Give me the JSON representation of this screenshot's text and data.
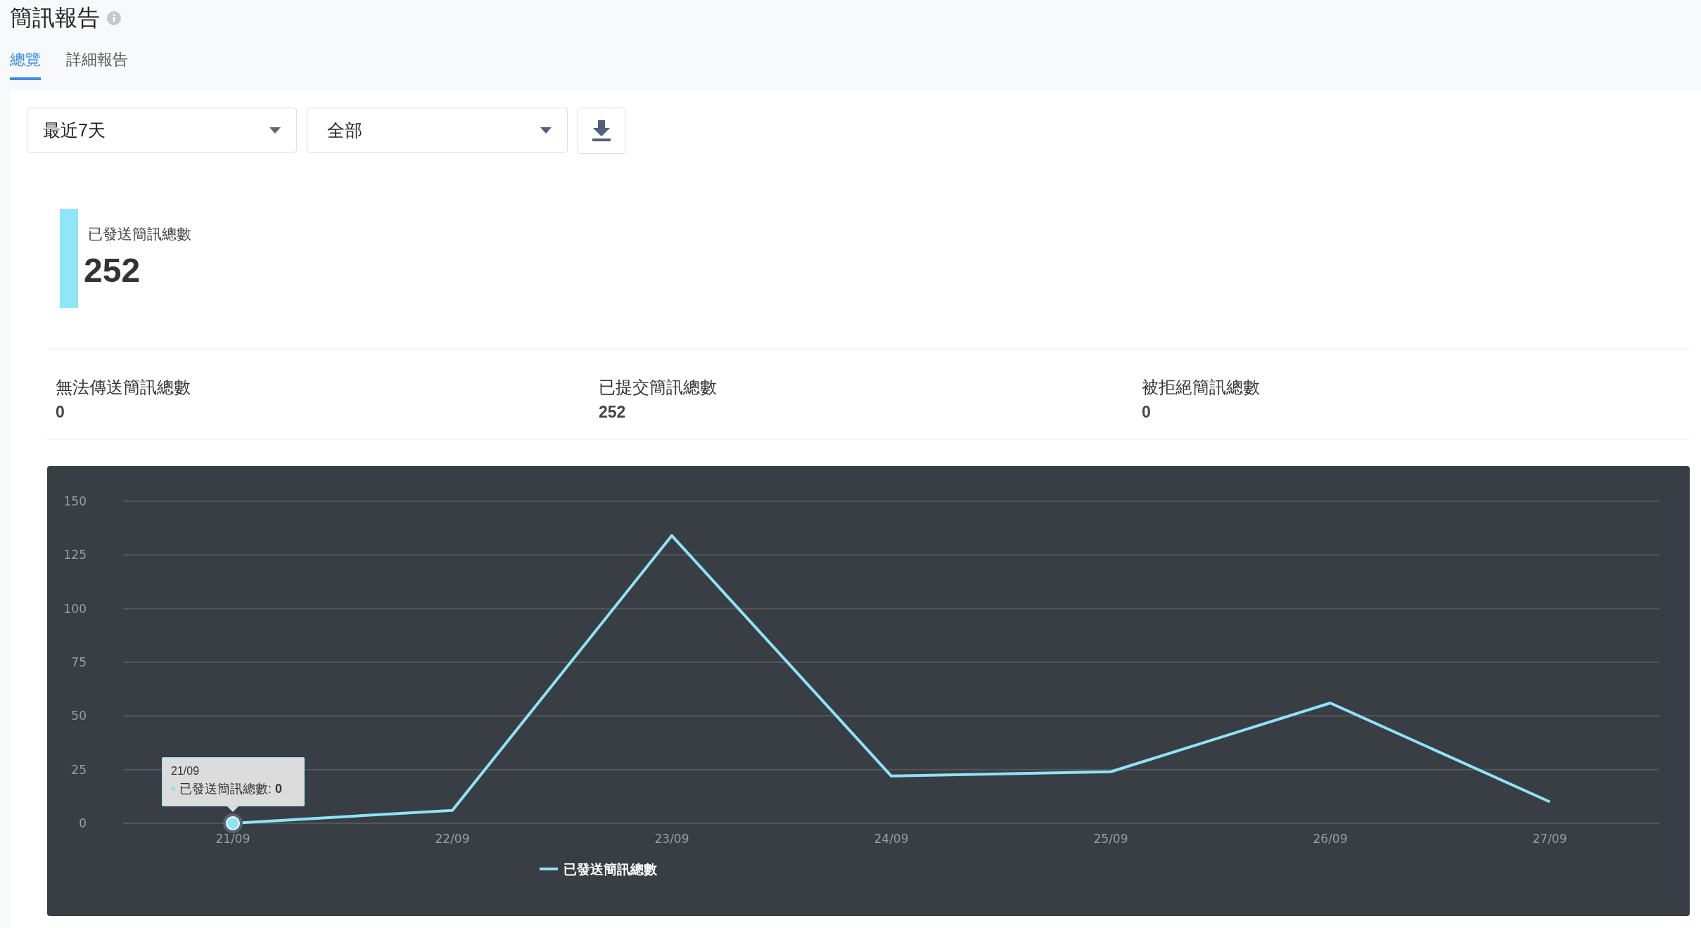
{
  "page": {
    "title": "簡訊報告"
  },
  "tabs": [
    {
      "label": "總覽",
      "selected": true
    },
    {
      "label": "詳細報告",
      "selected": false
    }
  ],
  "filters": [
    {
      "value": "最近7天"
    },
    {
      "value": "全部"
    }
  ],
  "highlight": {
    "label": "已發送簡訊總數",
    "value": "252"
  },
  "metrics": [
    {
      "label": "無法傳送簡訊總數",
      "value": "0"
    },
    {
      "label": "已提交簡訊總數",
      "value": "252"
    },
    {
      "label": "被拒絕簡訊總數",
      "value": "0"
    }
  ],
  "chart": {
    "tooltip": {
      "title": "21/09",
      "series": "已發送簡訊總數:",
      "value": "0"
    },
    "chart_data": {
      "type": "line",
      "categories": [
        "21/09",
        "22/09",
        "23/09",
        "24/09",
        "25/09",
        "26/09",
        "27/09"
      ],
      "series": [
        {
          "name": "已發送簡訊總數",
          "color": "#8de4f7",
          "values": [
            0,
            6,
            134,
            22,
            24,
            56,
            10
          ]
        }
      ],
      "grid": true,
      "ylim": [
        0,
        150
      ],
      "yticks": [
        0,
        25,
        50,
        75,
        100,
        125,
        150
      ]
    }
  }
}
